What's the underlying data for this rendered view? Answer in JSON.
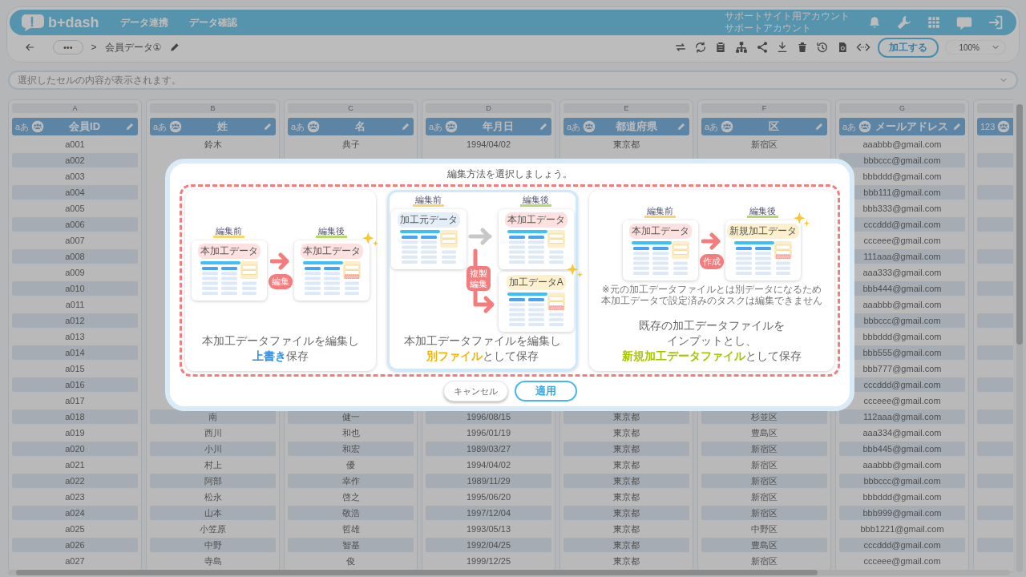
{
  "app": {
    "logo": "b+dash",
    "nav": [
      {
        "label": "データ連携"
      },
      {
        "label": "データ確認"
      }
    ],
    "account": {
      "site": "サポートサイト用アカウント",
      "name": "サポートアカウント"
    }
  },
  "toolbar": {
    "more": "•••",
    "separator": ">",
    "dataset": "会員データ①",
    "process_button": "加工する",
    "zoom": "100%"
  },
  "cell_preview": {
    "placeholder": "選択したセルの内容が表示されます。"
  },
  "table": {
    "columns": [
      {
        "letter": "A",
        "title": "会員ID",
        "type_label": "aあ"
      },
      {
        "letter": "B",
        "title": "姓",
        "type_label": "aあ"
      },
      {
        "letter": "C",
        "title": "名",
        "type_label": "aあ"
      },
      {
        "letter": "D",
        "title": "年月日",
        "type_label": "aあ"
      },
      {
        "letter": "E",
        "title": "都道府県",
        "type_label": "aあ"
      },
      {
        "letter": "F",
        "title": "区",
        "type_label": "aあ"
      },
      {
        "letter": "G",
        "title": "メールアドレス",
        "type_label": "aあ"
      },
      {
        "type_label": "123"
      }
    ],
    "rows": [
      {
        "A": "a001",
        "B": "鈴木",
        "C": "典子",
        "D": "1994/04/02",
        "E": "東京都",
        "F": "新宿区",
        "G": "aaabbb@gmail.com"
      },
      {
        "A": "a002",
        "G": "bbbccc@gmail.com"
      },
      {
        "A": "a003",
        "G": "bbbddd@gmail.com"
      },
      {
        "A": "a004",
        "G": "bbb111@gmail.com"
      },
      {
        "A": "a005",
        "G": "bbb333@gmail.com"
      },
      {
        "A": "a006",
        "G": "cccddd@gmail.com"
      },
      {
        "A": "a007",
        "G": "ccceee@gmail.com"
      },
      {
        "A": "a008",
        "G": "111aaa@gmail.com"
      },
      {
        "A": "a009",
        "G": "aaa333@gmail.com"
      },
      {
        "A": "a010",
        "G": "bbb444@gmail.com"
      },
      {
        "A": "a011",
        "G": "aaabbb@gmail.com"
      },
      {
        "A": "a012",
        "G": "bbbccc@gmail.com"
      },
      {
        "A": "a013",
        "G": "bbbddd@gmail.com"
      },
      {
        "A": "a014",
        "G": "bbb555@gmail.com"
      },
      {
        "A": "a015",
        "G": "bbb777@gmail.com"
      },
      {
        "A": "a016",
        "G": "cccddd@gmail.com"
      },
      {
        "A": "a017",
        "G": "ccceee@gmail.com"
      },
      {
        "A": "a018",
        "B": "南",
        "C": "健一",
        "D": "1996/08/15",
        "E": "東京都",
        "F": "杉並区",
        "G": "112aaa@gmail.com"
      },
      {
        "A": "a019",
        "B": "西川",
        "C": "和也",
        "D": "1996/01/19",
        "E": "東京都",
        "F": "豊島区",
        "G": "aaa334@gmail.com"
      },
      {
        "A": "a020",
        "B": "小川",
        "C": "和宏",
        "D": "1989/03/27",
        "E": "東京都",
        "F": "新宿区",
        "G": "bbb445@gmail.com"
      },
      {
        "A": "a021",
        "B": "村上",
        "C": "優",
        "D": "1994/04/02",
        "E": "東京都",
        "F": "新宿区",
        "G": "aaabbb@gmail.com"
      },
      {
        "A": "a022",
        "B": "阿部",
        "C": "幸作",
        "D": "1989/11/29",
        "E": "東京都",
        "F": "新宿区",
        "G": "bbbccc@gmail.com"
      },
      {
        "A": "a023",
        "B": "松永",
        "C": "啓之",
        "D": "1995/06/20",
        "E": "東京都",
        "F": "新宿区",
        "G": "bbbddd@gmail.com"
      },
      {
        "A": "a024",
        "B": "山本",
        "C": "敬浩",
        "D": "1997/12/04",
        "E": "東京都",
        "F": "新宿区",
        "G": "bbb999@gmail.com"
      },
      {
        "A": "a025",
        "B": "小笠原",
        "C": "哲雄",
        "D": "1993/05/13",
        "E": "東京都",
        "F": "中野区",
        "G": "bbb1221@gmail.com"
      },
      {
        "A": "a026",
        "B": "中野",
        "C": "智基",
        "D": "1992/04/25",
        "E": "東京都",
        "F": "豊島区",
        "G": "cccddd@gmail.com"
      },
      {
        "A": "a027",
        "B": "寺島",
        "C": "俊",
        "D": "1999/12/25",
        "E": "東京都",
        "F": "新宿区",
        "G": "ccceee@gmail.com"
      }
    ]
  },
  "dialog": {
    "title": "編集方法を選択しましょう。",
    "options": [
      {
        "selected": false,
        "color": "#2f8fe8",
        "illustration": {
          "kind": "single",
          "before": {
            "heading": "編集前",
            "docs": [
              {
                "label": "本加工データ",
                "color": "#fde0e0",
                "edited": false,
                "sparkle": false
              }
            ]
          },
          "action": {
            "label": "編集"
          },
          "after": {
            "heading": "編集後",
            "docs": [
              {
                "label": "本加工データ",
                "color": "#fde0e0",
                "edited": true,
                "sparkle": true
              }
            ]
          }
        },
        "caption": [
          [
            {
              "text": "本加工データファイルを編集し",
              "accent": false
            }
          ],
          [
            {
              "text": "上書き",
              "accent": true
            },
            {
              "text": "保存",
              "accent": false
            }
          ]
        ]
      },
      {
        "selected": true,
        "color": "#f5b400",
        "illustration": {
          "kind": "branch",
          "before": {
            "heading": "編集前",
            "docs": [
              {
                "label": "加工元データ",
                "color": "#e3eef9",
                "edited": false,
                "sparkle": false
              }
            ]
          },
          "action": {
            "label": "複製編集"
          },
          "after": {
            "heading": "編集後",
            "docs": [
              {
                "label": "本加工データ",
                "color": "#fde0e0",
                "edited": false,
                "sparkle": false
              },
              {
                "label": "加工データA",
                "color": "#fdf0cc",
                "edited": true,
                "sparkle": true
              }
            ]
          }
        },
        "caption": [
          [
            {
              "text": "本加工データファイルを編集し",
              "accent": false
            }
          ],
          [
            {
              "text": "別ファイル",
              "accent": true
            },
            {
              "text": "として保存",
              "accent": false
            }
          ]
        ]
      },
      {
        "selected": false,
        "color": "#a8c400",
        "illustration": {
          "kind": "single",
          "before": {
            "heading": "編集前",
            "docs": [
              {
                "label": "本加工データ",
                "color": "#fde0e0",
                "edited": false,
                "sparkle": false
              }
            ]
          },
          "action": {
            "label": "作成"
          },
          "after": {
            "heading": "編集後",
            "docs": [
              {
                "label": "新規加工データ",
                "color": "#fdf0cc",
                "edited": true,
                "sparkle": true
              }
            ]
          }
        },
        "note": [
          "※元の加工データファイルとは別データになるため",
          "本加工データで設定済みのタスクは編集できません"
        ],
        "caption": [
          [
            {
              "text": "既存の加工データファイルを",
              "accent": false
            }
          ],
          [
            {
              "text": "インプットとし、",
              "accent": false
            }
          ],
          [
            {
              "text": "新規加工データファイル",
              "accent": true
            },
            {
              "text": "として保存",
              "accent": false
            }
          ]
        ]
      }
    ],
    "buttons": [
      {
        "label": "キャンセル",
        "kind": "secondary"
      },
      {
        "label": "適用",
        "kind": "primary"
      }
    ]
  }
}
